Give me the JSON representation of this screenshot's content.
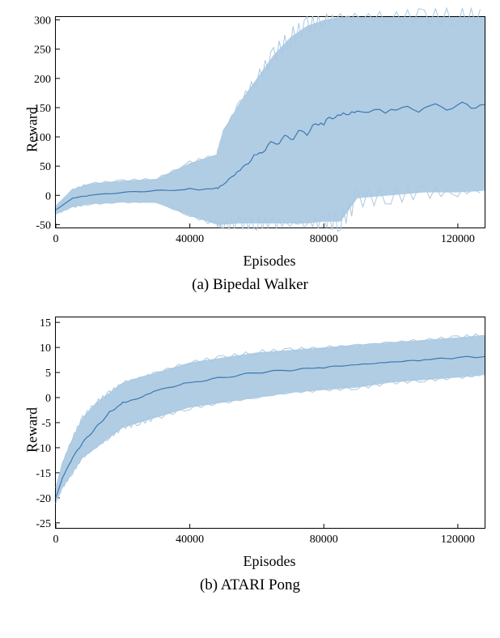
{
  "chart_data": [
    {
      "type": "line",
      "caption": "(a) Bipedal Walker",
      "xlabel": "Episodes",
      "ylabel": "Reward",
      "xlim": [
        0,
        128000
      ],
      "ylim": [
        -55,
        305
      ],
      "xticks": [
        0,
        40000,
        80000,
        120000
      ],
      "yticks": [
        -50,
        0,
        50,
        100,
        150,
        200,
        250,
        300
      ],
      "x": [
        0,
        5000,
        10000,
        20000,
        30000,
        40000,
        48000,
        50000,
        55000,
        60000,
        65000,
        70000,
        75000,
        80000,
        85000,
        90000,
        100000,
        110000,
        120000,
        128000
      ],
      "mean": [
        -25,
        -5,
        0,
        5,
        8,
        10,
        12,
        20,
        45,
        70,
        90,
        100,
        110,
        125,
        135,
        140,
        145,
        150,
        153,
        155
      ],
      "lo": [
        -32,
        -20,
        -15,
        -12,
        -12,
        -35,
        -50,
        -50,
        -48,
        -48,
        -48,
        -48,
        -48,
        -45,
        -45,
        -5,
        0,
        5,
        5,
        8
      ],
      "hi": [
        -18,
        10,
        20,
        25,
        28,
        55,
        70,
        110,
        160,
        200,
        240,
        270,
        290,
        300,
        305,
        305,
        305,
        305,
        305,
        305
      ],
      "series": [
        {
          "name": "reward",
          "values_ref": "mean",
          "band_lo_ref": "lo",
          "band_hi_ref": "hi"
        }
      ]
    },
    {
      "type": "line",
      "caption": "(b) ATARI Pong",
      "xlabel": "Episodes",
      "ylabel": "Reward",
      "xlim": [
        0,
        128000
      ],
      "ylim": [
        -26,
        16
      ],
      "xticks": [
        0,
        40000,
        80000,
        120000
      ],
      "yticks": [
        -25,
        -20,
        -15,
        -10,
        -5,
        0,
        5,
        10,
        15
      ],
      "x": [
        0,
        2000,
        5000,
        8000,
        12000,
        16000,
        20000,
        25000,
        30000,
        40000,
        50000,
        60000,
        70000,
        80000,
        90000,
        100000,
        110000,
        120000,
        128000
      ],
      "mean": [
        -20,
        -16,
        -12,
        -9,
        -6,
        -3,
        -1,
        0,
        1.5,
        3,
        4,
        5,
        5.5,
        6,
        6.5,
        7,
        7.5,
        8,
        8.2
      ],
      "lo": [
        -21,
        -18,
        -15,
        -12,
        -10,
        -8,
        -6,
        -5,
        -4,
        -2,
        -1,
        0,
        1,
        1.5,
        2,
        3,
        3.5,
        4,
        4.5
      ],
      "hi": [
        -18,
        -13,
        -8,
        -4,
        -1,
        1,
        3,
        4,
        5,
        7,
        8,
        9,
        9.5,
        10,
        10.5,
        11,
        11.5,
        12,
        12.5
      ],
      "series": [
        {
          "name": "reward",
          "values_ref": "mean",
          "band_lo_ref": "lo",
          "band_hi_ref": "hi"
        }
      ]
    }
  ]
}
